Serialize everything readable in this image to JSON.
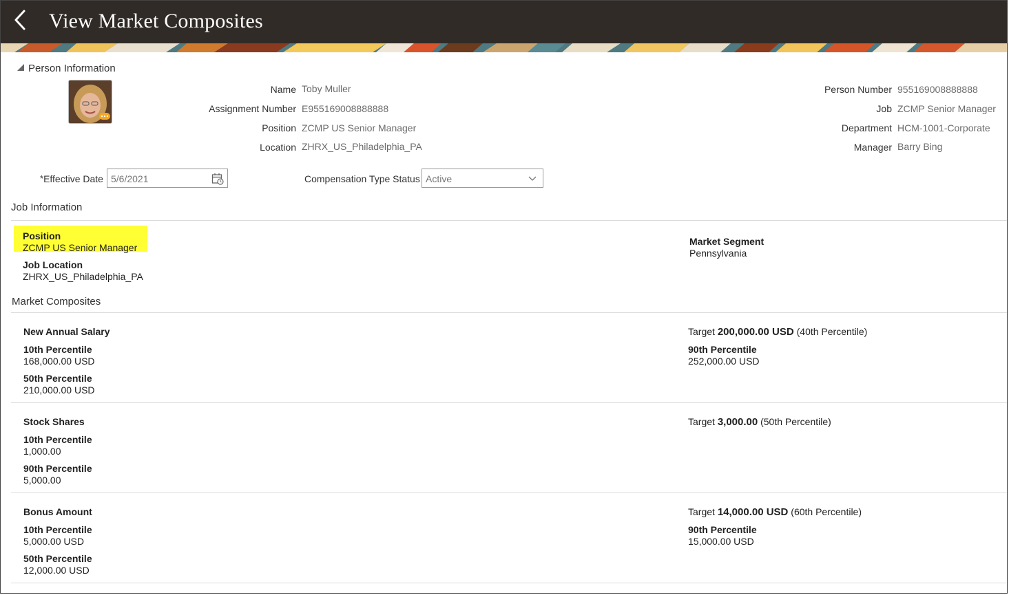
{
  "header": {
    "title": "View Market Composites"
  },
  "person_info": {
    "section_title": "Person Information",
    "fields_left": [
      {
        "label": "Name",
        "value": "Toby Muller"
      },
      {
        "label": "Assignment Number",
        "value": "E955169008888888"
      },
      {
        "label": "Position",
        "value": "ZCMP US Senior Manager"
      },
      {
        "label": "Location",
        "value": "ZHRX_US_Philadelphia_PA"
      }
    ],
    "fields_right": [
      {
        "label": "Person Number",
        "value": "955169008888888"
      },
      {
        "label": "Job",
        "value": "ZCMP Senior Manager"
      },
      {
        "label": "Department",
        "value": "HCM-1001-Corporate"
      },
      {
        "label": "Manager",
        "value": "Barry Bing"
      }
    ]
  },
  "filters": {
    "effective_date_required": "*",
    "effective_date_label": "Effective Date",
    "effective_date_value": "5/6/2021",
    "comp_status_label": "Compensation Type Status",
    "comp_status_value": "Active"
  },
  "job_info": {
    "section_title": "Job Information",
    "position_label": "Position",
    "position_value": "ZCMP US Senior Manager",
    "job_location_label": "Job Location",
    "job_location_value": "ZHRX_US_Philadelphia_PA",
    "market_segment_label": "Market Segment",
    "market_segment_value": "Pennsylvania"
  },
  "market_composites": {
    "section_title": "Market Composites",
    "groups": [
      {
        "name": "New Annual Salary",
        "target_label": "Target",
        "target_value": "200,000.00 USD",
        "target_percentile": "(40th Percentile)",
        "left": [
          {
            "label": "10th Percentile",
            "value": "168,000.00 USD"
          },
          {
            "label": "50th Percentile",
            "value": "210,000.00 USD"
          }
        ],
        "right": [
          {
            "label": "90th Percentile",
            "value": "252,000.00 USD"
          }
        ]
      },
      {
        "name": "Stock Shares",
        "target_label": "Target",
        "target_value": "3,000.00",
        "target_percentile": "(50th Percentile)",
        "left": [
          {
            "label": "10th Percentile",
            "value": "1,000.00"
          },
          {
            "label": "90th Percentile",
            "value": "5,000.00"
          }
        ],
        "right": []
      },
      {
        "name": "Bonus Amount",
        "target_label": "Target",
        "target_value": "14,000.00 USD",
        "target_percentile": "(60th Percentile)",
        "left": [
          {
            "label": "10th Percentile",
            "value": "5,000.00 USD"
          },
          {
            "label": "50th Percentile",
            "value": "12,000.00 USD"
          }
        ],
        "right": [
          {
            "label": "90th Percentile",
            "value": "15,000.00 USD"
          }
        ]
      }
    ]
  },
  "colors": {
    "header_bg": "#302b27",
    "highlight": "#ffff33"
  }
}
